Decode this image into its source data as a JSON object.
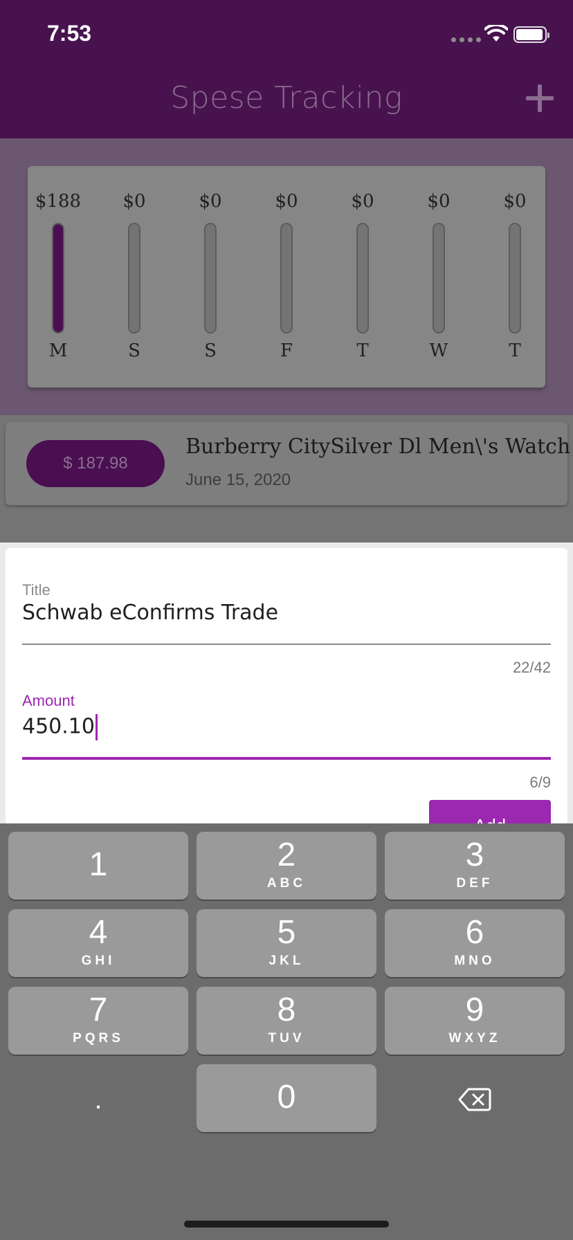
{
  "status_bar": {
    "time": "7:53"
  },
  "app_bar": {
    "title": "Spese Tracking"
  },
  "chart_data": {
    "type": "bar",
    "categories": [
      "M",
      "S",
      "S",
      "F",
      "T",
      "W",
      "T"
    ],
    "values": [
      188,
      0,
      0,
      0,
      0,
      0,
      0
    ],
    "value_labels": [
      "$188",
      "$0",
      "$0",
      "$0",
      "$0",
      "$0",
      "$0"
    ],
    "ylim": [
      0,
      188
    ]
  },
  "transactions": [
    {
      "amount": "$ 187.98",
      "title": "Burberry CitySilver Dl Men\\'s Watch",
      "date": "June 15, 2020"
    }
  ],
  "form": {
    "title_label": "Title",
    "title_value": "Schwab eConfirms Trade",
    "title_counter": "22/42",
    "amount_label": "Amount",
    "amount_value": "450.10",
    "amount_counter": "6/9",
    "add_label": "Add"
  },
  "keyboard": {
    "keys": [
      {
        "num": "1",
        "letters": ""
      },
      {
        "num": "2",
        "letters": "ABC"
      },
      {
        "num": "3",
        "letters": "DEF"
      },
      {
        "num": "4",
        "letters": "GHI"
      },
      {
        "num": "5",
        "letters": "JKL"
      },
      {
        "num": "6",
        "letters": "MNO"
      },
      {
        "num": "7",
        "letters": "PQRS"
      },
      {
        "num": "8",
        "letters": "TUV"
      },
      {
        "num": "9",
        "letters": "WXYZ"
      },
      {
        "num": "0",
        "letters": ""
      }
    ],
    "decimal": "."
  },
  "icons": {
    "add": "plus-icon",
    "backspace": "backspace-icon",
    "wifi": "wifi-icon",
    "battery": "battery-icon",
    "signal": "cellular-signal-icon"
  },
  "colors": {
    "app_bar": "#48124f",
    "accent": "#9c27b0",
    "bar_fill": "#4a0f50"
  }
}
